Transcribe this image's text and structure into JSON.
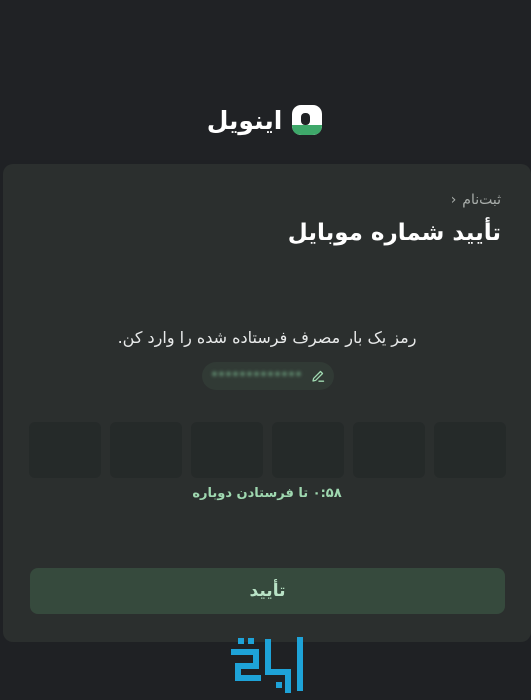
{
  "brand": {
    "name": "اینویل",
    "logo_icon": "app-logo-icon",
    "logo_colors": {
      "primary": "#ffffff",
      "accent": "#3ea86a"
    }
  },
  "breadcrumb": {
    "label": "ثبت‌نام",
    "chevron_icon": "chevron-icon"
  },
  "page": {
    "title": "تأیید شماره موبایل",
    "instruction": "رمز یک بار مصرف فرستاده شده را وارد کن."
  },
  "phone": {
    "masked_number": "*************",
    "edit_icon": "edit-pencil-icon"
  },
  "otp": {
    "length": 6,
    "values": [
      "",
      "",
      "",
      "",
      "",
      ""
    ]
  },
  "resend": {
    "text": "۰:۵۸ تا فرستادن دوباره"
  },
  "actions": {
    "confirm_label": "تأیید"
  },
  "colors": {
    "background": "#1f2124",
    "card": "#2b2f2e",
    "accent_text": "#9fd8b0",
    "button_bg": "#364a3d"
  },
  "watermark": {
    "icon": "watermark-logo-icon",
    "color": "#1ea3d8"
  }
}
